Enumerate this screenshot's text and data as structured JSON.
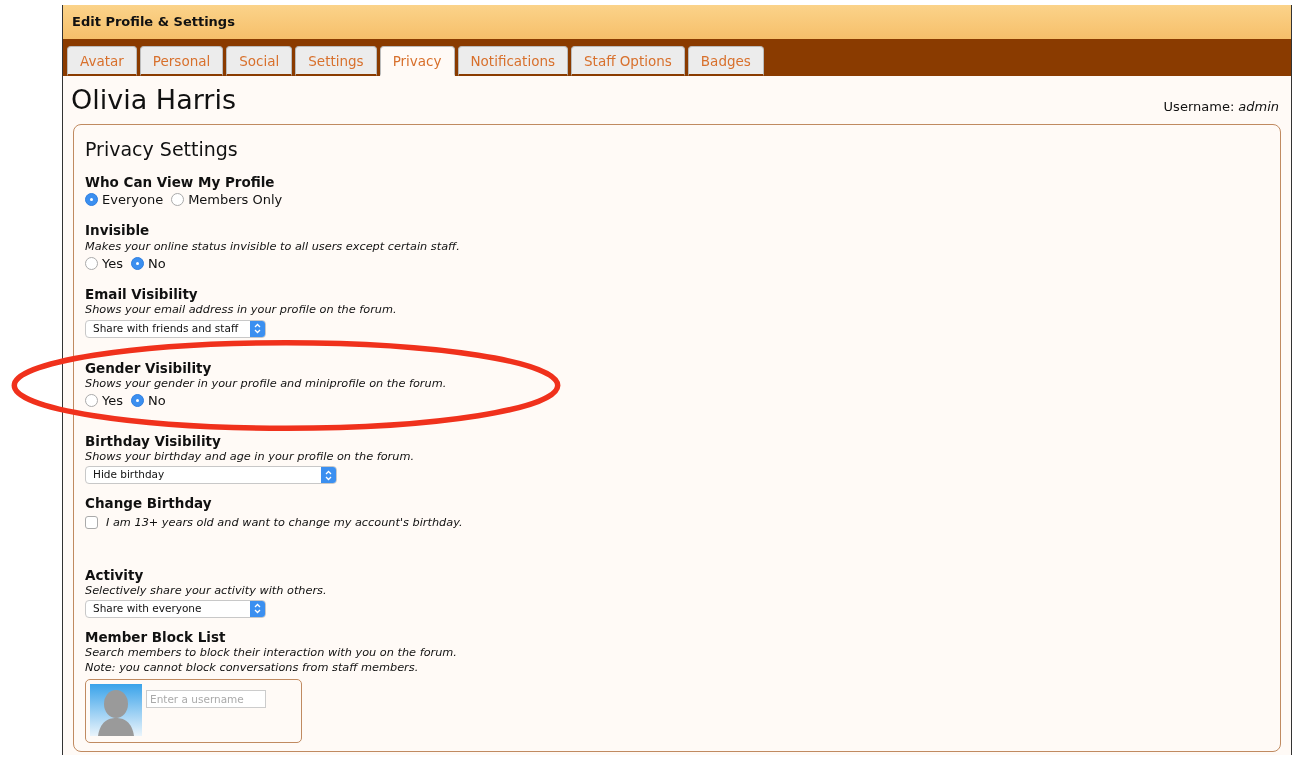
{
  "window": {
    "title": "Edit Profile & Settings"
  },
  "tabs": [
    {
      "label": "Avatar",
      "selected": false
    },
    {
      "label": "Personal",
      "selected": false
    },
    {
      "label": "Social",
      "selected": false
    },
    {
      "label": "Settings",
      "selected": false
    },
    {
      "label": "Privacy",
      "selected": true
    },
    {
      "label": "Notifications",
      "selected": false
    },
    {
      "label": "Staff Options",
      "selected": false
    },
    {
      "label": "Badges",
      "selected": false
    }
  ],
  "profile": {
    "name": "Olivia Harris",
    "username_label": "Username:",
    "username": "admin"
  },
  "panel": {
    "title": "Privacy Settings"
  },
  "sections": [
    {
      "kind": "radio",
      "title": "Who Can View My Profile",
      "options": [
        {
          "label": "Everyone",
          "selected": true
        },
        {
          "label": "Members Only",
          "selected": false
        }
      ]
    },
    {
      "kind": "radio",
      "title": "Invisible",
      "description": "Makes your online status invisible to all users except certain staff.",
      "options": [
        {
          "label": "Yes",
          "selected": false
        },
        {
          "label": "No",
          "selected": true
        }
      ]
    },
    {
      "kind": "select",
      "title": "Email Visibility",
      "description": "Shows your email address in your profile on the forum.",
      "value": "Share with friends and staff",
      "wide": false
    },
    {
      "kind": "radio",
      "title": "Gender Visibility",
      "highlighted": true,
      "description": "Shows your gender in your profile and miniprofile on the forum.",
      "options": [
        {
          "label": "Yes",
          "selected": false
        },
        {
          "label": "No",
          "selected": true
        }
      ]
    },
    {
      "kind": "select",
      "title": "Birthday Visibility",
      "description": "Shows your birthday and age in your profile on the forum.",
      "value": "Hide birthday",
      "wide": true
    },
    {
      "kind": "checkbox",
      "title": "Change Birthday",
      "label": "I am 13+ years old and want to change my account's birthday.",
      "checked": false
    },
    {
      "kind": "select",
      "title": "Activity",
      "description": "Selectively share your activity with others.",
      "value": "Share with everyone",
      "wide": false
    },
    {
      "kind": "blocklist",
      "title": "Member Block List",
      "description": "Search members to block their interaction with you on the forum.",
      "note": "Note: you cannot block conversations from staff members.",
      "placeholder": "Enter a username"
    }
  ]
}
